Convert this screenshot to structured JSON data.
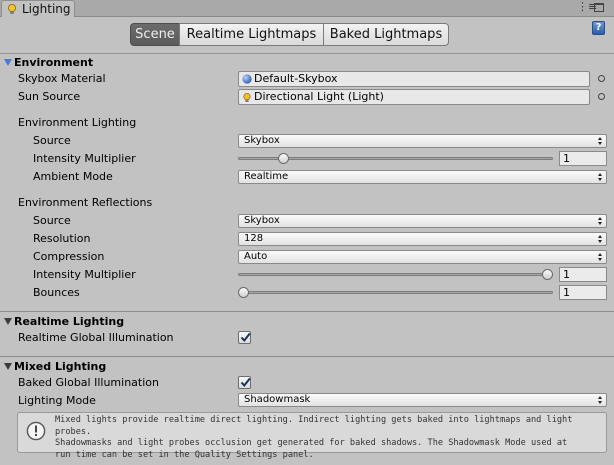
{
  "window": {
    "tab_title": "Lighting",
    "help_label": "?"
  },
  "mode_tabs": [
    {
      "label": "Scene",
      "active": true
    },
    {
      "label": "Realtime Lightmaps",
      "active": false
    },
    {
      "label": "Baked Lightmaps",
      "active": false
    }
  ],
  "environment": {
    "title": "Environment",
    "skybox_material": {
      "label": "Skybox Material",
      "value": "Default-Skybox"
    },
    "sun_source": {
      "label": "Sun Source",
      "value": "Directional Light (Light)"
    },
    "lighting": {
      "title": "Environment Lighting",
      "source": {
        "label": "Source",
        "value": "Skybox"
      },
      "intensity": {
        "label": "Intensity Multiplier",
        "value": "1",
        "fraction": 0.13
      },
      "ambient_mode": {
        "label": "Ambient Mode",
        "value": "Realtime"
      }
    },
    "reflections": {
      "title": "Environment Reflections",
      "source": {
        "label": "Source",
        "value": "Skybox"
      },
      "resolution": {
        "label": "Resolution",
        "value": "128"
      },
      "compression": {
        "label": "Compression",
        "value": "Auto"
      },
      "intensity": {
        "label": "Intensity Multiplier",
        "value": "1",
        "fraction": 1.0
      },
      "bounces": {
        "label": "Bounces",
        "value": "1",
        "fraction": 0.0
      }
    }
  },
  "realtime_lighting": {
    "title": "Realtime Lighting",
    "global_illumination": {
      "label": "Realtime Global Illumination",
      "checked": true
    }
  },
  "mixed_lighting": {
    "title": "Mixed Lighting",
    "baked_gi": {
      "label": "Baked Global Illumination",
      "checked": true
    },
    "lighting_mode": {
      "label": "Lighting Mode",
      "value": "Shadowmask"
    },
    "help_lines": [
      "Mixed lights provide realtime direct lighting. Indirect lighting gets baked into lightmaps and light probes.",
      "Shadowmasks and light probes occlusion get generated for baked shadows. The Shadowmask Mode used at",
      "run time can be set in the Quality Settings panel."
    ]
  },
  "colors": {
    "panel_bg": "#c2c2c2",
    "accent": "#4a7bd1",
    "active_tab": "#5b5b5b"
  }
}
